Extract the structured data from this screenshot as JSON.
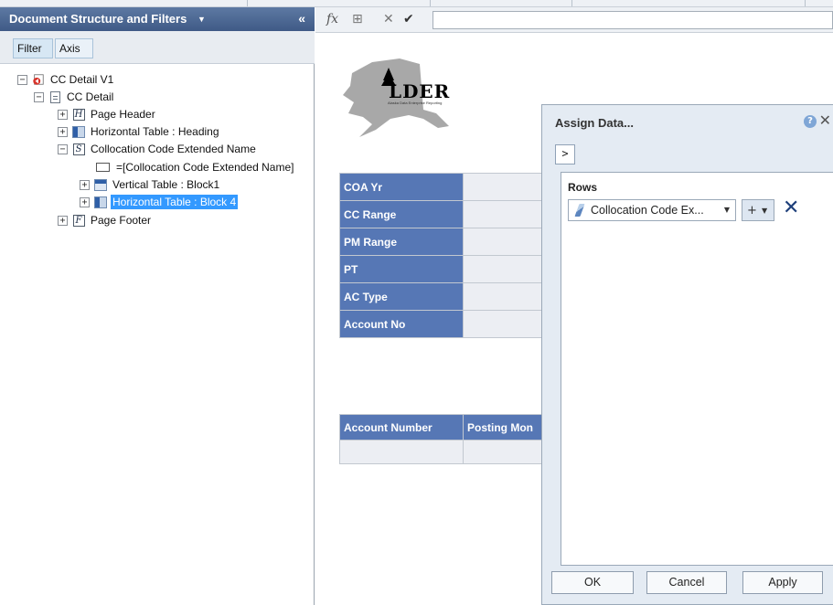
{
  "left_panel": {
    "title": "Document Structure and Filters",
    "collapse_symbol": "«",
    "tabs": {
      "filter": "Filter",
      "axis": "Axis"
    },
    "tree": {
      "root": "CC Detail V1",
      "report": "CC Detail",
      "page_header": "Page Header",
      "heading_table": "Horizontal Table : Heading",
      "section": "Collocation Code Extended Name",
      "cell": "=[Collocation Code Extended Name]",
      "vertical_table": "Vertical Table : Block1",
      "block4_table": "Horizontal Table : Block 4",
      "page_footer": "Page Footer"
    }
  },
  "formula_bar": {
    "fx_label": "fx",
    "value": ""
  },
  "report": {
    "logo_text": "LDER",
    "logo_subtitle": "Alaska Data Enterprise Reporting",
    "filter_labels": [
      "COA Yr",
      "CC Range",
      "PM Range",
      "PT",
      "AC Type",
      "Account No"
    ],
    "block_headers": [
      "Account Number",
      "Posting Mon"
    ]
  },
  "dialog": {
    "title": "Assign Data...",
    "expand_label": ">",
    "rows_title": "Rows",
    "row_dimension": "Collocation Code Ex...",
    "plus_label": "+",
    "buttons": {
      "ok": "OK",
      "cancel": "Cancel",
      "apply": "Apply"
    }
  }
}
